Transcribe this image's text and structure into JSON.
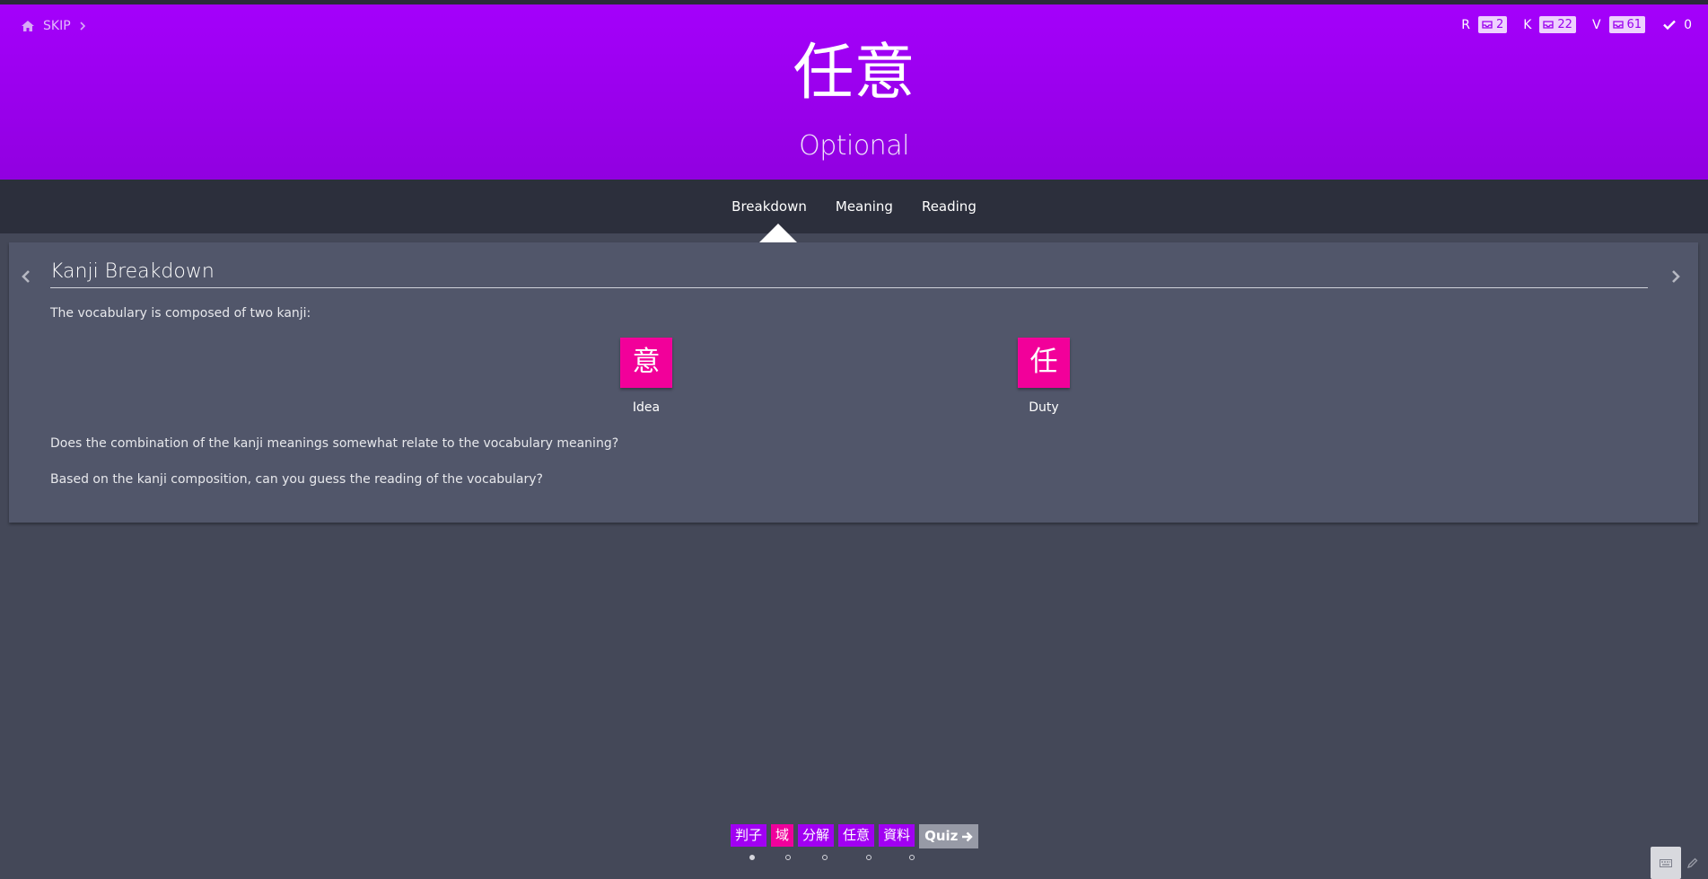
{
  "header": {
    "skip_label": "SKIP",
    "vocab": "任意",
    "meaning": "Optional",
    "accent": "#a100f2"
  },
  "stats": {
    "radicals": {
      "letter": "R",
      "count": "2"
    },
    "kanji": {
      "letter": "K",
      "count": "22"
    },
    "vocabulary": {
      "letter": "V",
      "count": "61"
    },
    "completed": "0"
  },
  "tabs": [
    {
      "label": "Breakdown",
      "active": true
    },
    {
      "label": "Meaning",
      "active": false
    },
    {
      "label": "Reading",
      "active": false
    }
  ],
  "panel": {
    "title": "Kanji Breakdown",
    "intro": "The vocabulary is composed of two kanji:",
    "kanji": [
      {
        "char": "意",
        "meaning": "Idea"
      },
      {
        "char": "任",
        "meaning": "Duty"
      }
    ],
    "question1": "Does the combination of the kanji meanings somewhat relate to the vocabulary meaning?",
    "question2": "Based on the kanji composition, can you guess the reading of the vocabulary?"
  },
  "queue": {
    "items": [
      {
        "text": "判子",
        "type": "vocabulary"
      },
      {
        "text": "域",
        "type": "kanji"
      },
      {
        "text": "分解",
        "type": "vocabulary"
      },
      {
        "text": "任意",
        "type": "vocabulary"
      },
      {
        "text": "資料",
        "type": "vocabulary"
      }
    ],
    "quiz_label": "Quiz",
    "current_index": 0
  },
  "colors": {
    "kanji_pink": "#f2009a",
    "vocab_purple": "#a100f2",
    "background": "#444858"
  }
}
